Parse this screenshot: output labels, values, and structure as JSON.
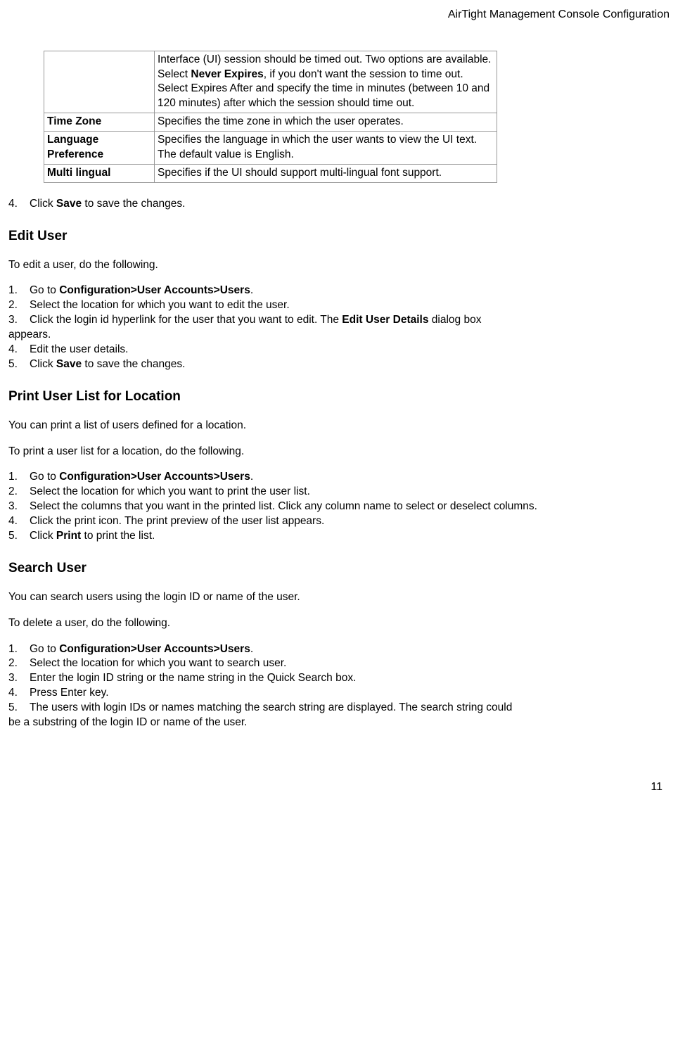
{
  "header": "AirTight Management Console Configuration",
  "table": {
    "rows": [
      {
        "label": "",
        "desc_pre": "Interface (UI) session should be timed out. Two options are available. Select ",
        "desc_bold": "Never Expires",
        "desc_post": ", if you don't want the session to time out. Select Expires After and specify the time in minutes (between 10 and 120 minutes) after which the session should time out."
      },
      {
        "label": "Time Zone",
        "desc": "Specifies the time zone in which the user operates."
      },
      {
        "label": "Language Preference",
        "desc": "Specifies the language in which the user wants to view the UI text. The default value is English."
      },
      {
        "label": "Multi lingual",
        "desc": "Specifies if the UI should support multi-lingual font support."
      }
    ]
  },
  "step4": {
    "num": "4.",
    "pre": "Click ",
    "bold": "Save",
    "post": " to save the changes."
  },
  "editUser": {
    "heading": "Edit User",
    "intro": "To edit a user, do the following.",
    "steps": {
      "s1": {
        "num": "1.",
        "pre": "Go to ",
        "bold": "Configuration>User Accounts>Users",
        "post": "."
      },
      "s2": {
        "num": "2.",
        "text": "Select the location for which you want to edit the user."
      },
      "s3": {
        "num": "3.",
        "pre": "Click the login id hyperlink for the user that you want to edit. The ",
        "bold": "Edit User Details",
        "post": " dialog box"
      },
      "s3cont": "appears.",
      "s4": {
        "num": "4.",
        "text": "Edit the user details."
      },
      "s5": {
        "num": "5.",
        "pre": "Click ",
        "bold": "Save",
        "post": " to save the changes."
      }
    }
  },
  "printUser": {
    "heading": "Print User List for Location",
    "intro1": "You can print a list of users defined for a location.",
    "intro2": "To print a user list for a location, do the following.",
    "steps": {
      "s1": {
        "num": "1.",
        "pre": "Go to ",
        "bold": "Configuration>User Accounts>Users",
        "post": "."
      },
      "s2": {
        "num": "2.",
        "text": "Select the location for which you want to print the user list."
      },
      "s3": {
        "num": "3.",
        "text": "Select the columns that you want in the printed list. Click any column name to select or deselect columns."
      },
      "s4": {
        "num": "4.",
        "text": "Click the print icon. The print preview of the user list appears."
      },
      "s5": {
        "num": "5.",
        "pre": "Click ",
        "bold": "Print",
        "post": " to print the list."
      }
    }
  },
  "searchUser": {
    "heading": "Search User",
    "intro1": "You can search users using the login ID or name of the user.",
    "intro2": "To delete a user, do the following.",
    "steps": {
      "s1": {
        "num": "1.",
        "pre": "Go to ",
        "bold": "Configuration>User Accounts>Users",
        "post": "."
      },
      "s2": {
        "num": "2.",
        "text": "Select the location for which you want to search user."
      },
      "s3": {
        "num": "3.",
        "text": "Enter the login ID string or the name string in the Quick Search box."
      },
      "s4": {
        "num": "4.",
        "text": "Press Enter key."
      },
      "s5": {
        "num": "5.",
        "text": "The users with login IDs or names matching the search string are displayed. The search string could"
      },
      "s5cont": "be a substring of the login ID or name of the user."
    }
  },
  "pageNum": "11"
}
